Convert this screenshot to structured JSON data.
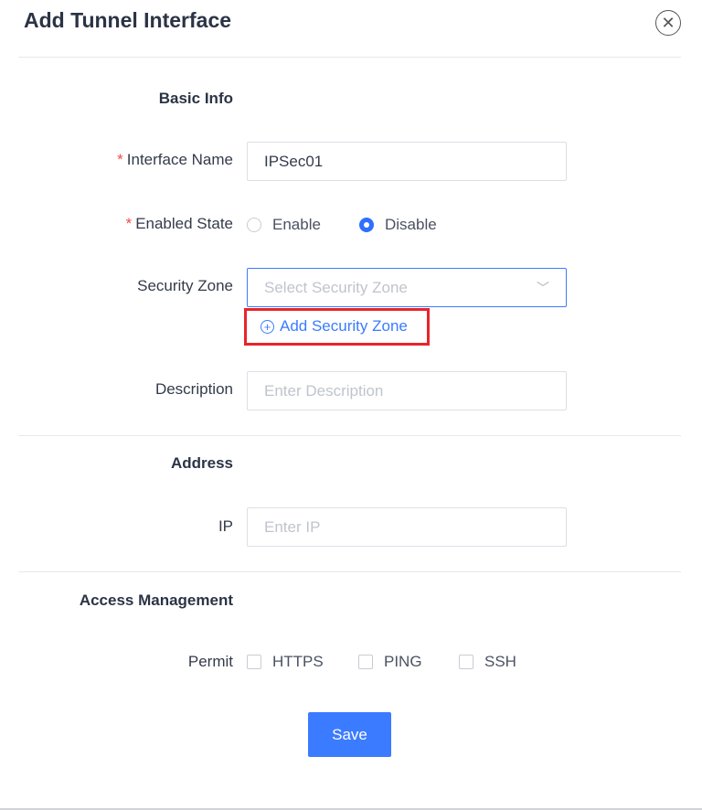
{
  "dialog": {
    "title": "Add Tunnel Interface",
    "close_icon": "close-circle-icon"
  },
  "basic": {
    "heading": "Basic Info",
    "interface_name": {
      "label": "Interface Name",
      "value": "IPSec01",
      "required": true
    },
    "enabled_state": {
      "label": "Enabled State",
      "required": true,
      "options": [
        "Enable",
        "Disable"
      ],
      "selected": "Disable"
    },
    "security_zone": {
      "label": "Security Zone",
      "placeholder": "Select  Security Zone",
      "add_link": "Add Security Zone"
    },
    "description": {
      "label": "Description",
      "placeholder": "Enter  Description"
    }
  },
  "address": {
    "heading": "Address",
    "ip": {
      "label": "IP",
      "placeholder": "Enter  IP"
    }
  },
  "access": {
    "heading": "Access Management",
    "permit_label": "Permit",
    "options": [
      "HTTPS",
      "PING",
      "SSH"
    ]
  },
  "save_label": "Save",
  "colors": {
    "primary": "#3b7bff",
    "highlight": "#e8242b",
    "required": "#f04a4a"
  }
}
